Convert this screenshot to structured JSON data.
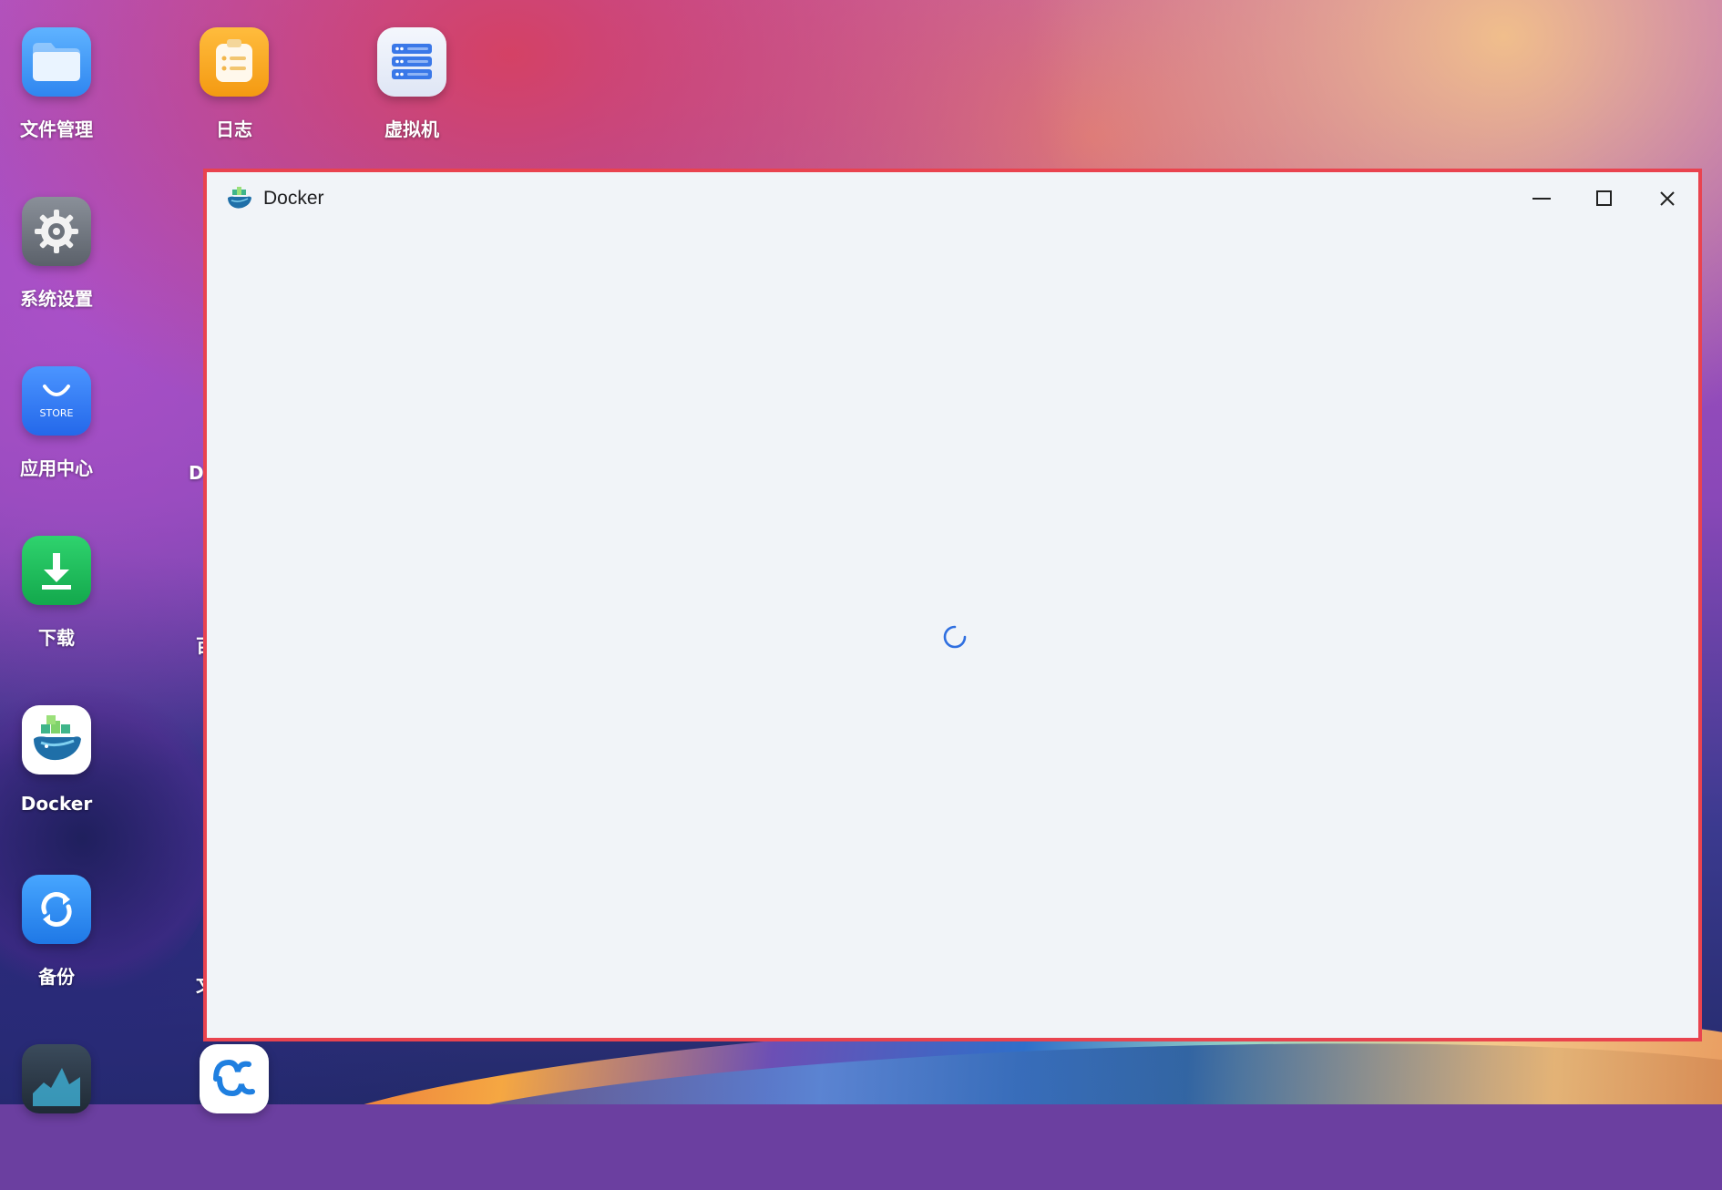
{
  "desktop": {
    "icons": [
      {
        "label": "文件管理",
        "icon": "folder-icon",
        "color": "#3d9df5"
      },
      {
        "label": "日志",
        "icon": "log-icon",
        "color": "#f7a21b"
      },
      {
        "label": "虚拟机",
        "icon": "server-icon",
        "color": "#e8eefb"
      },
      {
        "label": "系统设置",
        "icon": "gear-icon",
        "color": "#6f7680"
      },
      {
        "label": "应用中心",
        "icon": "store-icon",
        "color": "#2f7cf6",
        "tile_text": "STORE"
      },
      {
        "label": "下载",
        "icon": "download-icon",
        "color": "#19c25a"
      },
      {
        "label": "Docker",
        "icon": "docker-icon",
        "color": "#ffffff"
      },
      {
        "label": "备份",
        "icon": "backup-icon",
        "color": "#2f8ff0"
      }
    ],
    "partial_labels": [
      "D",
      "百",
      "文"
    ]
  },
  "window": {
    "title": "Docker",
    "border_color": "#e9434f",
    "background": "#f1f4f8",
    "controls": [
      "minimize-icon",
      "maximize-icon",
      "close-icon"
    ],
    "state": "loading",
    "spinner_color": "#2f6fe0"
  }
}
